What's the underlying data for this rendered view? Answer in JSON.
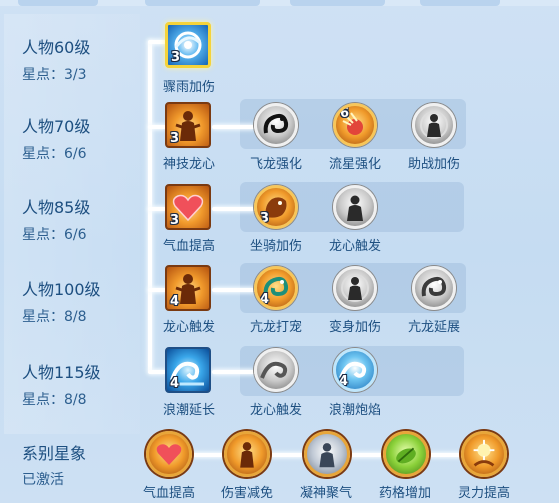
{
  "levels": [
    {
      "name": "人物60级",
      "stars": "星点：3/3"
    },
    {
      "name": "人物70级",
      "stars": "星点：6/6"
    },
    {
      "name": "人物85级",
      "stars": "星点：6/6"
    },
    {
      "name": "人物100级",
      "stars": "星点：8/8"
    },
    {
      "name": "人物115级",
      "stars": "星点：8/8"
    }
  ],
  "rows": [
    {
      "main": {
        "label": "骤雨加伤",
        "count": "3",
        "icon": "vortex-icon"
      },
      "subs": []
    },
    {
      "main": {
        "label": "神技龙心",
        "count": "3",
        "icon": "warrior-icon"
      },
      "subs": [
        {
          "label": "飞龙强化",
          "count": "",
          "icon": "dragon-icon"
        },
        {
          "label": "流星强化",
          "count": "6",
          "icon": "meteor-icon"
        },
        {
          "label": "助战加伤",
          "count": "",
          "icon": "aura-figure-icon"
        }
      ]
    },
    {
      "main": {
        "label": "气血提高",
        "count": "3",
        "icon": "heart-icon"
      },
      "subs": [
        {
          "label": "坐骑加伤",
          "count": "3",
          "icon": "beast-icon"
        },
        {
          "label": "龙心触发",
          "count": "",
          "icon": "figure-icon"
        }
      ]
    },
    {
      "main": {
        "label": "龙心触发",
        "count": "4",
        "icon": "warrior-icon"
      },
      "subs": [
        {
          "label": "亢龙打宠",
          "count": "4",
          "icon": "dragon-icon"
        },
        {
          "label": "变身加伤",
          "count": "",
          "icon": "aura-figure-icon"
        },
        {
          "label": "亢龙延展",
          "count": "",
          "icon": "dragon-icon"
        }
      ]
    },
    {
      "main": {
        "label": "浪潮延长",
        "count": "4",
        "icon": "wave-icon"
      },
      "subs": [
        {
          "label": "龙心触发",
          "count": "",
          "icon": "wave-icon"
        },
        {
          "label": "浪潮炮焰",
          "count": "4",
          "icon": "wave-icon"
        }
      ]
    }
  ],
  "constellation": {
    "title": "系别星象",
    "status": "已激活",
    "items": [
      {
        "label": "气血提高",
        "icon": "heart-icon"
      },
      {
        "label": "伤害减免",
        "icon": "warrior-icon"
      },
      {
        "label": "凝神聚气",
        "icon": "figure-icon"
      },
      {
        "label": "药格增加",
        "icon": "herb-icon"
      },
      {
        "label": "灵力提高",
        "icon": "spark-hand-icon"
      }
    ]
  }
}
